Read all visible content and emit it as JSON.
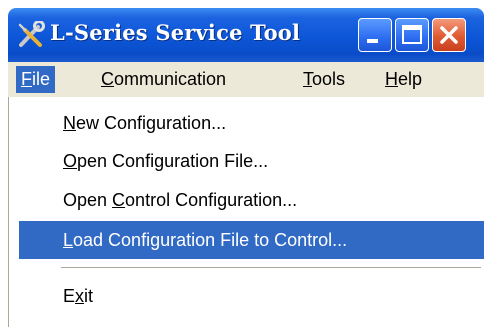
{
  "window": {
    "title": "L-Series Service Tool",
    "icon": "tools-icon",
    "controls": [
      "minimize-icon",
      "maximize-icon",
      "close-icon"
    ]
  },
  "menubar": {
    "items": [
      {
        "pre": "",
        "ul": "F",
        "post": "ile",
        "active": true
      },
      {
        "pre": "",
        "ul": "C",
        "post": "ommunication",
        "active": false
      },
      {
        "pre": "",
        "ul": "T",
        "post": "ools",
        "active": false
      },
      {
        "pre": "",
        "ul": "H",
        "post": "elp",
        "active": false
      }
    ]
  },
  "file_menu": {
    "items": [
      {
        "pre": "",
        "ul": "N",
        "post": "ew Configuration..."
      },
      {
        "pre": "",
        "ul": "O",
        "post": "pen Configuration File..."
      },
      {
        "pre": "Open ",
        "ul": "C",
        "post": "ontrol Configuration..."
      },
      {
        "pre": "",
        "ul": "L",
        "post": "oad Configuration File to Control...",
        "highlighted": true
      },
      {
        "pre": "E",
        "ul": "x",
        "post": "it"
      }
    ]
  },
  "colors": {
    "titlebar": "#0c56d8",
    "menu_highlight": "#316ac5",
    "menubar_bg": "#ece9d8",
    "close_button": "#e05a32"
  }
}
